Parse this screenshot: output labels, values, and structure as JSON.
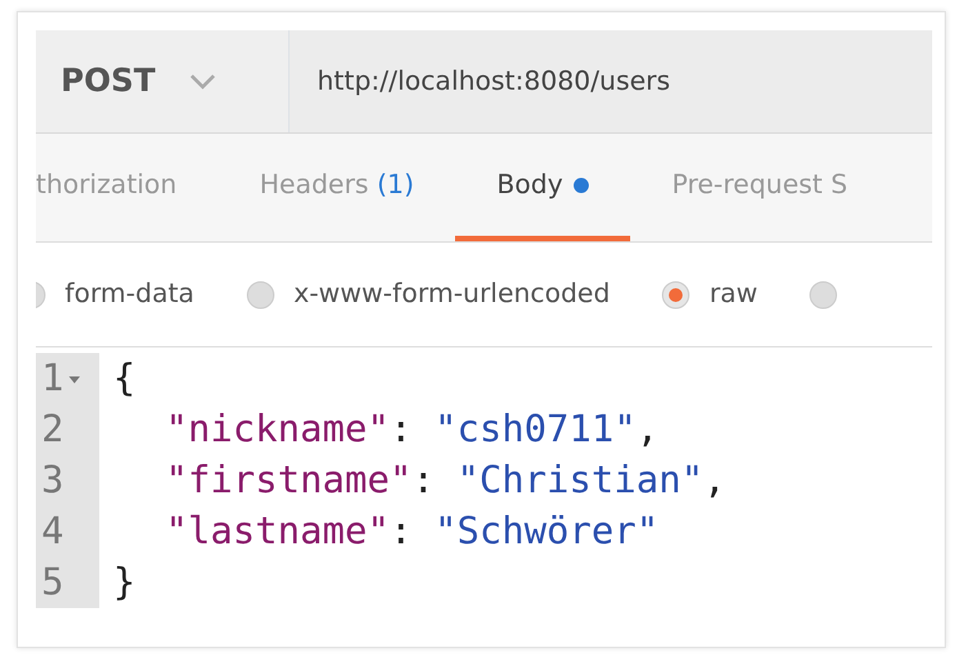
{
  "request": {
    "method": "POST",
    "url": "http://localhost:8080/users"
  },
  "tabs": [
    {
      "label": "thorization",
      "selected": false,
      "modified": false
    },
    {
      "label": "Headers",
      "count": "(1)",
      "selected": false,
      "modified": false
    },
    {
      "label": "Body",
      "selected": true,
      "modified": true
    },
    {
      "label": "Pre-request S",
      "selected": false,
      "modified": false
    }
  ],
  "body_types": [
    {
      "label": "form-data",
      "selected": false
    },
    {
      "label": "x-www-form-urlencoded",
      "selected": false
    },
    {
      "label": "raw",
      "selected": true
    },
    {
      "selected": false
    }
  ],
  "editor": {
    "lines": [
      {
        "number": "1",
        "foldable": true,
        "indented": false,
        "tokens": [
          {
            "kind": "punct",
            "text": "{"
          }
        ]
      },
      {
        "number": "2",
        "foldable": false,
        "indented": true,
        "tokens": [
          {
            "kind": "key",
            "text": "\"nickname\""
          },
          {
            "kind": "punct",
            "text": ": "
          },
          {
            "kind": "string",
            "text": "\"csh0711\""
          },
          {
            "kind": "punct",
            "text": ","
          }
        ]
      },
      {
        "number": "3",
        "foldable": false,
        "indented": true,
        "tokens": [
          {
            "kind": "key",
            "text": "\"firstname\""
          },
          {
            "kind": "punct",
            "text": ": "
          },
          {
            "kind": "string",
            "text": "\"Christian\""
          },
          {
            "kind": "punct",
            "text": ","
          }
        ]
      },
      {
        "number": "4",
        "foldable": false,
        "indented": true,
        "tokens": [
          {
            "kind": "key",
            "text": "\"lastname\""
          },
          {
            "kind": "punct",
            "text": ": "
          },
          {
            "kind": "string",
            "text": "\"Schwörer\""
          }
        ]
      },
      {
        "number": "5",
        "foldable": false,
        "indented": false,
        "tokens": [
          {
            "kind": "punct",
            "text": "}"
          }
        ]
      }
    ]
  }
}
